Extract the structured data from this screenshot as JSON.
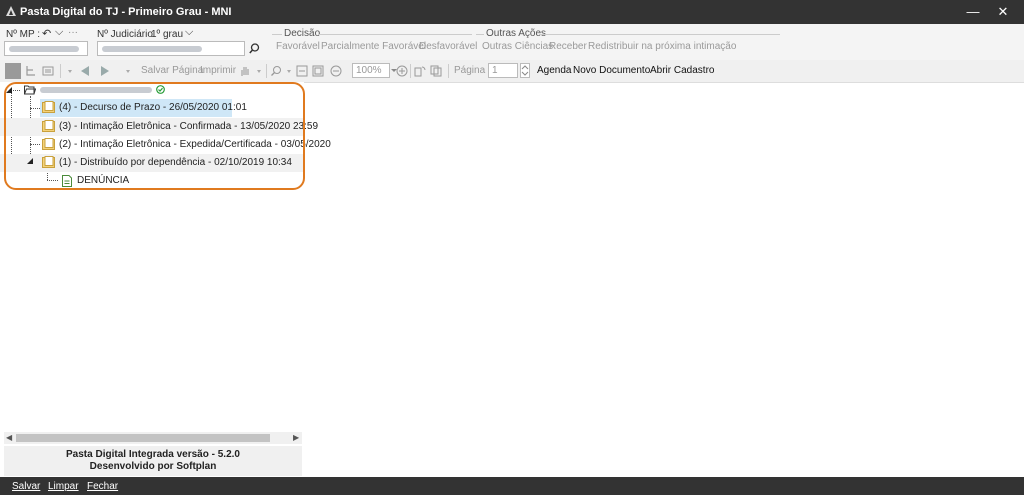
{
  "window": {
    "title": "Pasta Digital do TJ - Primeiro Grau - MNI",
    "minimize": "—",
    "close": "✕"
  },
  "header": {
    "mp_label": "Nº MP :",
    "mp_undo": "↶",
    "mp_chevron": "⌵",
    "mp_more": "···",
    "judicial_label": "Nº Judiciário",
    "instance": "1º grau",
    "instance_chevron": "⌵",
    "decisao": {
      "title": "Decisão",
      "buttons": [
        "Favorável",
        "Parcialmente Favorável",
        "Desfavorável"
      ]
    },
    "outras_acoes": {
      "title": "Outras Ações",
      "buttons": [
        "Outras Ciências",
        "Receber",
        "Redistribuir na próxima intimação"
      ]
    }
  },
  "toolbar": {
    "salvar_pagina": "Salvar Página",
    "imprimir": "Imprimir",
    "zoom": "100%",
    "pagina_label": "Página :",
    "pagina_value": "1",
    "agenda": "Agenda",
    "novo_documento": "Novo Documento",
    "abrir_cadastro": "Abrir Cadastro"
  },
  "tree": {
    "items": [
      {
        "label": "(4) - Decurso de Prazo - 26/05/2020 01:01"
      },
      {
        "label": "(3) - Intimação Eletrônica - Confirmada - 13/05/2020 23:59"
      },
      {
        "label": "(2) - Intimação Eletrônica - Expedida/Certificada - 03/05/2020"
      },
      {
        "label": "(1) - Distribuído por dependência - 02/10/2019 10:34"
      }
    ],
    "child": {
      "label": "DENÚNCIA"
    }
  },
  "footer": {
    "version": "Pasta Digital Integrada versão - 5.2.0",
    "developer": "Desenvolvido por Softplan"
  },
  "bottom": {
    "salvar": "Salvar",
    "limpar": "Limpar",
    "fechar": "Fechar"
  }
}
